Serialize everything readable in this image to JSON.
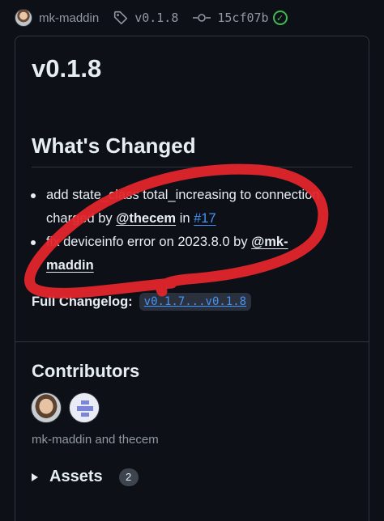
{
  "topbar": {
    "author": "mk-maddin",
    "tag": "v0.1.8",
    "commit": "15cf07b",
    "verified_icon": "check-circle-icon",
    "tag_icon": "tag-icon",
    "commit_icon": "git-commit-icon"
  },
  "release": {
    "title": "v0.1.8",
    "section_title": "What's Changed",
    "changes": [
      {
        "text_before": "add state_class total_increasing to connection charged by ",
        "mention": "@thecem",
        "text_mid": " in ",
        "issue": "#17"
      },
      {
        "text_before": "fix deviceinfo error on 2023.8.0 by ",
        "mention": "@mk-maddin"
      }
    ],
    "full_changelog_label": "Full Changelog:",
    "compare_link": "v0.1.7...v0.1.8"
  },
  "contributors": {
    "title": "Contributors",
    "names": "mk-maddin and thecem"
  },
  "assets": {
    "label": "Assets",
    "count": "2"
  },
  "colors": {
    "background": "#0d1117",
    "link": "#4493f8",
    "verified": "#3fb950",
    "annotation_stroke": "#e3262b"
  }
}
